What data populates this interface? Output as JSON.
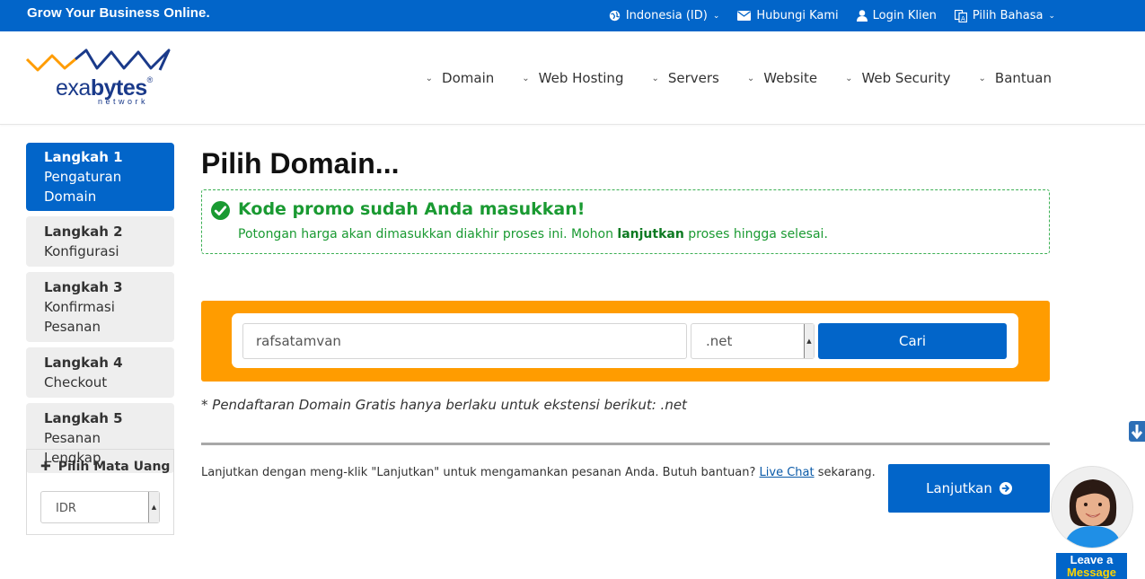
{
  "topbar": {
    "slogan": "Grow Your Business Online.",
    "links": [
      {
        "label": "Indonesia (ID)",
        "icon": "globe-icon",
        "dropdown": true
      },
      {
        "label": "Hubungi Kami",
        "icon": "envelope-icon",
        "dropdown": false
      },
      {
        "label": "Login Klien",
        "icon": "user-icon",
        "dropdown": false
      },
      {
        "label": "Pilih Bahasa",
        "icon": "language-icon",
        "dropdown": true
      }
    ]
  },
  "logo": {
    "prefix": "exa",
    "brand": "bytes",
    "reg": "®",
    "sub": "network"
  },
  "nav": [
    "Domain",
    "Web Hosting",
    "Servers",
    "Website",
    "Web Security",
    "Bantuan"
  ],
  "steps": [
    {
      "title": "Langkah 1",
      "subtitle": "Pengaturan Domain",
      "active": true
    },
    {
      "title": "Langkah 2",
      "subtitle": "Konfigurasi",
      "active": false
    },
    {
      "title": "Langkah 3",
      "subtitle": "Konfirmasi Pesanan",
      "active": false
    },
    {
      "title": "Langkah 4",
      "subtitle": "Checkout",
      "active": false
    },
    {
      "title": "Langkah 5",
      "subtitle": "Pesanan Lengkap",
      "active": false
    }
  ],
  "currency": {
    "heading": "Pilih Mata Uang",
    "selected": "IDR"
  },
  "page_title": "Pilih Domain...",
  "alert": {
    "heading": "Kode promo sudah Anda masukkan!",
    "text_before": "Potongan harga akan dimasukkan diakhir proses ini. Mohon ",
    "text_bold": "lanjutkan",
    "text_after": " proses hingga selesai."
  },
  "search": {
    "domain_value": "rafsatamvan",
    "tld_selected": ".net",
    "button_label": "Cari"
  },
  "note": "* Pendaftaran Domain Gratis hanya berlaku untuk ekstensi berikut: .net",
  "help": {
    "before": "Lanjutkan dengan meng-klik \"Lanjutkan\" untuk mengamankan pesanan Anda. Butuh bantuan? ",
    "link": "Live Chat",
    "after": " sekarang."
  },
  "continue_label": "Lanjutkan",
  "chat": {
    "line1": "Leave a",
    "line2": "Message"
  },
  "colors": {
    "primary": "#0265c9",
    "orange": "#ff9c00",
    "success": "#1a9a32"
  }
}
